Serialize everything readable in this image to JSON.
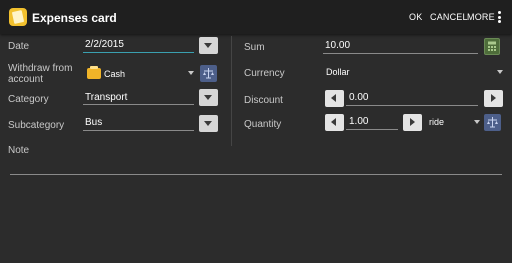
{
  "header": {
    "title": "Expenses card",
    "actions": {
      "ok": "OK",
      "cancel": "CANCEL",
      "more": "MORE"
    }
  },
  "left": {
    "date": {
      "label": "Date",
      "value": "2/2/2015"
    },
    "withdraw": {
      "label_line1": "Withdraw from",
      "label_line2": "account",
      "value": "Cash"
    },
    "category": {
      "label": "Category",
      "value": "Transport"
    },
    "subcategory": {
      "label": "Subcategory",
      "value": "Bus"
    },
    "note": {
      "label": "Note"
    }
  },
  "right": {
    "sum": {
      "label": "Sum",
      "value": "10.00"
    },
    "currency": {
      "label": "Currency",
      "value": "Dollar"
    },
    "discount": {
      "label": "Discount",
      "value": "0.00"
    },
    "quantity": {
      "label": "Quantity",
      "value": "1.00",
      "unit": "ride"
    }
  },
  "colors": {
    "background": "#2c2c2c",
    "actionbar": "#1f1f1f",
    "accent_underline": "#3aa0b0",
    "app_icon": "#f2c12e"
  },
  "icons": {
    "app": "expenses-card-icon",
    "wallet": "wallet-icon",
    "scale": "scale-icon",
    "calculator": "calculator-icon",
    "overflow": "more-vert-icon"
  }
}
